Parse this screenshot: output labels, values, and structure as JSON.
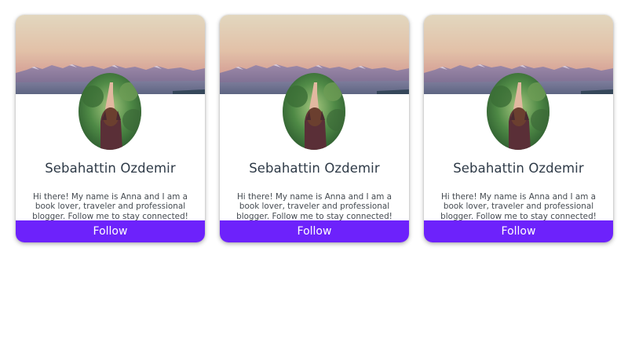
{
  "colors": {
    "accent": "#6d22fb",
    "name_text": "#2e3a47",
    "bio_text": "#444a50"
  },
  "cards": [
    {
      "name": "Sebahattin Ozdemir",
      "bio": "Hi there! My name is Anna and I am a book lover, traveler and professional blogger. Follow me to stay connected!",
      "follow_label": "Follow"
    },
    {
      "name": "Sebahattin Ozdemir",
      "bio": "Hi there! My name is Anna and I am a book lover, traveler and professional blogger. Follow me to stay connected!",
      "follow_label": "Follow"
    },
    {
      "name": "Sebahattin Ozdemir",
      "bio": "Hi there! My name is Anna and I am a book lover, traveler and professional blogger. Follow me to stay connected!",
      "follow_label": "Follow"
    }
  ]
}
